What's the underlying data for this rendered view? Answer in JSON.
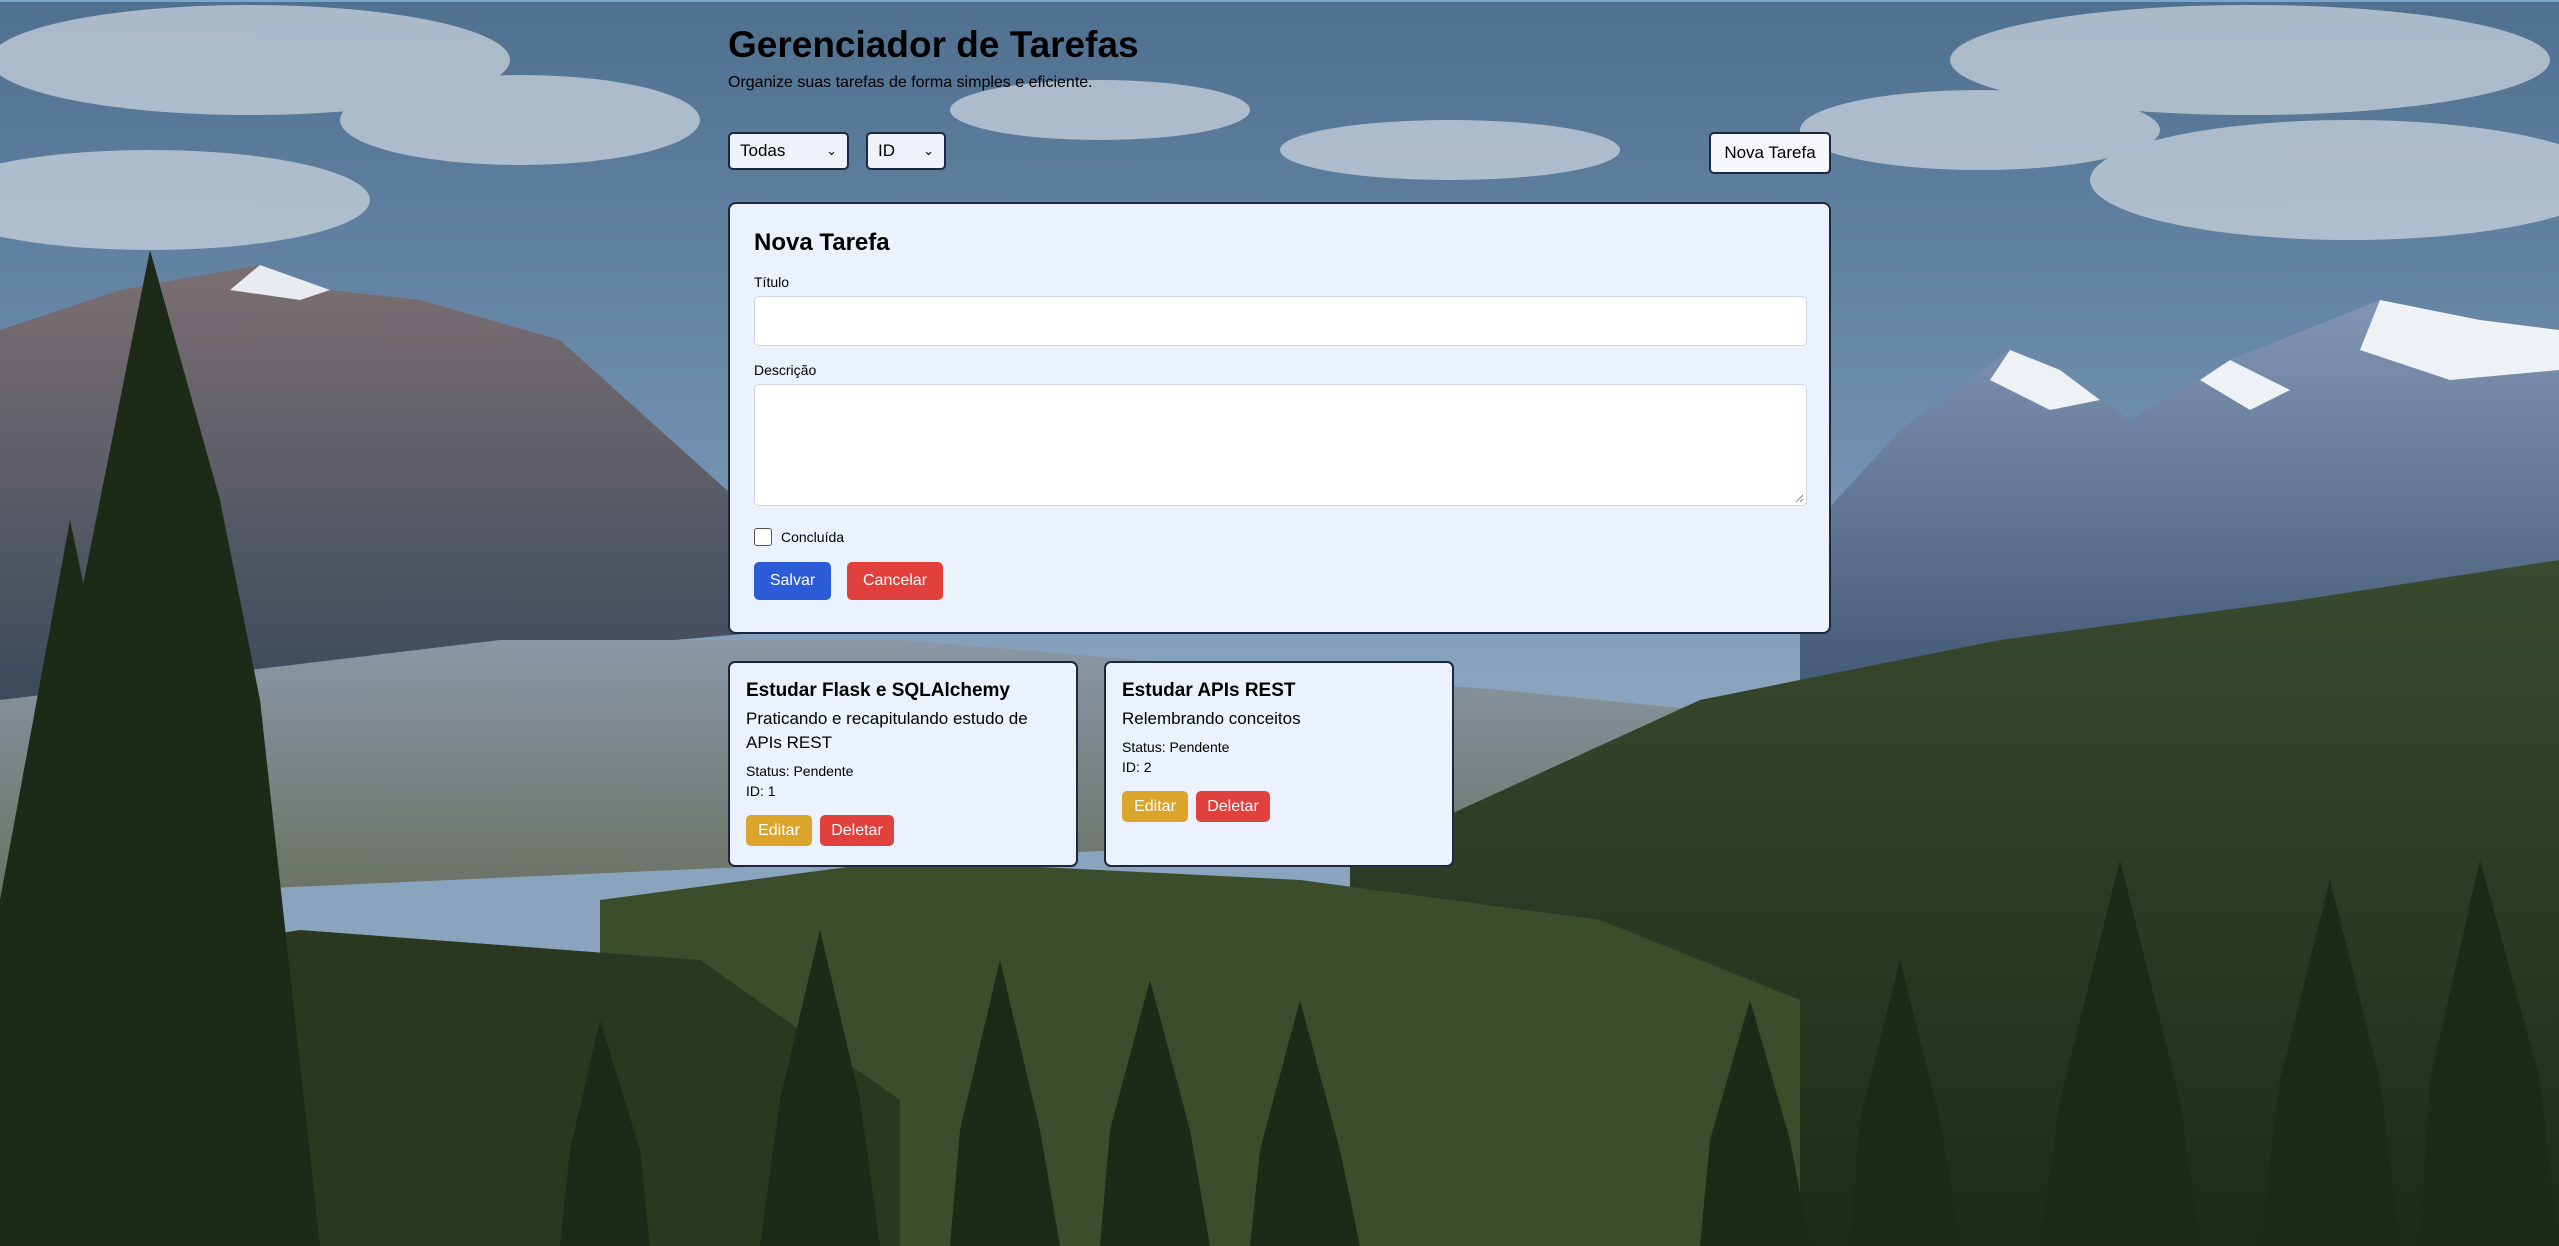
{
  "header": {
    "title": "Gerenciador de Tarefas",
    "subtitle": "Organize suas tarefas de forma simples e eficiente."
  },
  "toolbar": {
    "filter_selected": "Todas",
    "sort_selected": "ID",
    "new_task_label": "Nova Tarefa"
  },
  "form": {
    "title": "Nova Tarefa",
    "title_label": "Título",
    "title_value": "",
    "description_label": "Descrição",
    "description_value": "",
    "completed_label": "Concluída",
    "completed_checked": false,
    "save_label": "Salvar",
    "cancel_label": "Cancelar"
  },
  "tasks": [
    {
      "title": "Estudar Flask e SQLAlchemy",
      "description": "Praticando e recapitulando estudo de APIs REST",
      "status": "Status: Pendente",
      "id": "ID: 1",
      "edit_label": "Editar",
      "delete_label": "Deletar"
    },
    {
      "title": "Estudar APIs REST",
      "description": "Relembrando conceitos",
      "status": "Status: Pendente",
      "id": "ID: 2",
      "edit_label": "Editar",
      "delete_label": "Deletar"
    }
  ],
  "colors": {
    "primary": "#2b5bd7",
    "danger": "#e2403d",
    "warning": "#dba52c",
    "card_bg": "#ebf2fd",
    "border": "#1c2742"
  }
}
